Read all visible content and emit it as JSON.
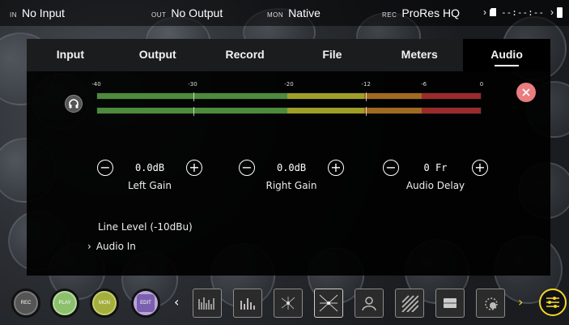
{
  "status_bar": {
    "input": {
      "tag": "IN",
      "value": "No Input"
    },
    "output": {
      "tag": "OUT",
      "value": "No Output"
    },
    "monitor": {
      "tag": "MON",
      "value": "Native"
    },
    "record": {
      "tag": "REC",
      "value": "ProRes HQ",
      "timecode": "--:--:--"
    }
  },
  "tabs": [
    {
      "label": "Input",
      "active": false
    },
    {
      "label": "Output",
      "active": false
    },
    {
      "label": "Record",
      "active": false
    },
    {
      "label": "File",
      "active": false
    },
    {
      "label": "Meters",
      "active": false
    },
    {
      "label": "Audio",
      "active": true
    }
  ],
  "meters": {
    "scale_labels": [
      "-40",
      "-30",
      "-20",
      "-12",
      "-6",
      "0"
    ],
    "channels": 2,
    "colors": {
      "green": "#4c8c3c",
      "yellow": "#9f9f27",
      "orange": "#a06b20",
      "red": "#9b2b2b"
    }
  },
  "controls": {
    "left_gain": {
      "value": "0.0dB",
      "label": "Left Gain"
    },
    "right_gain": {
      "value": "0.0dB",
      "label": "Right Gain"
    },
    "audio_delay": {
      "value": "0 Fr",
      "label": "Audio Delay"
    }
  },
  "line_level": "Line Level (-10dBu)",
  "audio_in": "Audio In",
  "toolbar": {
    "rec": "REC",
    "play": "PLAY",
    "mon": "MON",
    "edit": "EDIT",
    "tools": [
      "waveform-icon",
      "audio-meters-icon",
      "focus-peaking-icon",
      "zebra-crosshair-icon",
      "false-color-icon",
      "zebra-stripes-icon",
      "frame-guides-icon",
      "zoom-icon"
    ]
  },
  "accent_color": "#f2d72c",
  "close_color": "#e97d80"
}
